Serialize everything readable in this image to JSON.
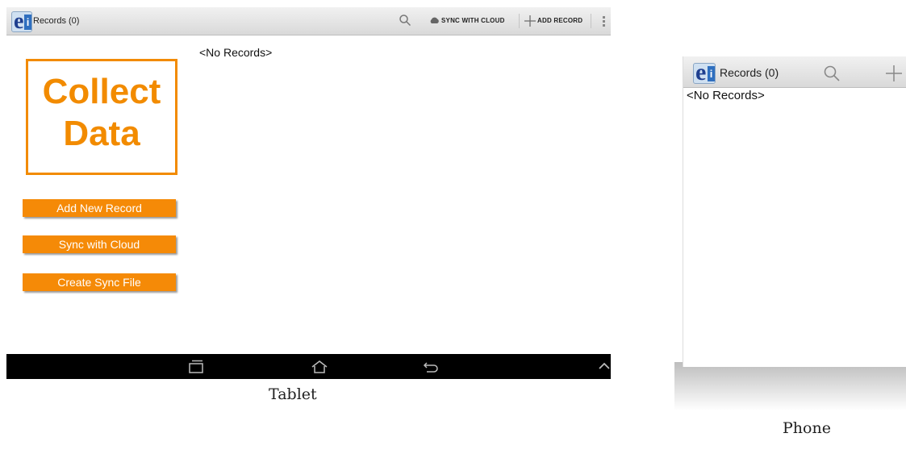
{
  "tablet": {
    "caption": "Tablet",
    "action_bar": {
      "title": "Records (0)",
      "sync_label": "SYNC WITH CLOUD",
      "add_label": "ADD RECORD",
      "icons": [
        "search-icon",
        "cloud-icon",
        "plus-icon",
        "overflow-menu-icon"
      ]
    },
    "logo_text": [
      "Collect",
      "Data"
    ],
    "buttons": [
      "Add New Record",
      "Sync with Cloud",
      "Create Sync File"
    ],
    "empty_text": "<No Records>",
    "nav_icons": [
      "recents-icon",
      "home-icon",
      "back-icon",
      "chevron-up-icon"
    ]
  },
  "phone": {
    "caption": "Phone",
    "action_bar": {
      "title": "Records (0)",
      "icons": [
        "search-icon",
        "plus-icon"
      ]
    },
    "empty_text": "<No Records>"
  },
  "colors": {
    "accent_orange": "#f58a07",
    "action_bar": "#e3e3e3",
    "nav_bar": "#000000",
    "logo_blue": "#2f6fbf"
  }
}
